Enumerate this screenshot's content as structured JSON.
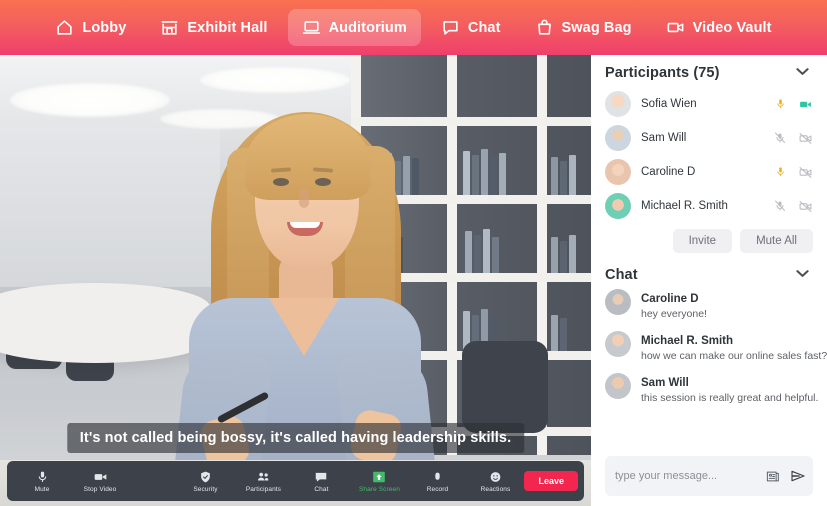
{
  "nav": {
    "items": [
      {
        "label": "Lobby",
        "icon": "home-icon",
        "active": false
      },
      {
        "label": "Exhibit Hall",
        "icon": "storefront-icon",
        "active": false
      },
      {
        "label": "Auditorium",
        "icon": "laptop-icon",
        "active": true
      },
      {
        "label": "Chat",
        "icon": "chat-bubble-icon",
        "active": false
      },
      {
        "label": "Swag Bag",
        "icon": "shopping-bag-icon",
        "active": false
      },
      {
        "label": "Video Vault",
        "icon": "video-camera-icon",
        "active": false
      }
    ]
  },
  "stage": {
    "caption": "It's not called being bossy, it's called having leadership skills.",
    "toolbar": {
      "buttons": [
        {
          "label": "Mute",
          "icon": "microphone-icon",
          "highlight": false
        },
        {
          "label": "Stop Video",
          "icon": "video-camera-icon",
          "highlight": false
        },
        {
          "label": "Security",
          "icon": "shield-icon",
          "highlight": false
        },
        {
          "label": "Participants",
          "icon": "people-icon",
          "highlight": false
        },
        {
          "label": "Chat",
          "icon": "chat-bubble-icon",
          "highlight": false
        },
        {
          "label": "Share Screen",
          "icon": "share-screen-icon",
          "highlight": true
        },
        {
          "label": "Record",
          "icon": "record-icon",
          "highlight": false
        },
        {
          "label": "Reactions",
          "icon": "reactions-icon",
          "highlight": false
        }
      ],
      "leave_label": "Leave",
      "share_color": "#3fbb6a",
      "leave_color": "#f2264f"
    }
  },
  "participants": {
    "title": "Participants (75)",
    "collapse_icon": "chevron-down-icon",
    "rows": [
      {
        "name": "Sofia Wien",
        "mic": "on",
        "cam": "on",
        "avatar_color": "#d9dcdf"
      },
      {
        "name": "Sam Will",
        "mic": "muted",
        "cam": "off",
        "avatar_color": "#cdd6de"
      },
      {
        "name": "Caroline D",
        "mic": "on",
        "cam": "off",
        "avatar_color": "#e6c5ae"
      },
      {
        "name": "Michael R. Smith",
        "mic": "muted",
        "cam": "off",
        "avatar_color": "#7fd3bb"
      }
    ],
    "invite_label": "Invite",
    "mute_all_label": "Mute All",
    "mic_on_color": "#f2b12a",
    "cam_on_color": "#2ec4a6",
    "off_color": "#b9bcc1"
  },
  "chat": {
    "title": "Chat",
    "collapse_icon": "chevron-down-icon",
    "messages": [
      {
        "name": "Caroline D",
        "text": "hey everyone!",
        "avatar_color": "#bfc2c6"
      },
      {
        "name": "Michael R. Smith",
        "text": "how we can make our online sales fast?",
        "avatar_color": "#c9ccd1"
      },
      {
        "name": "Sam Will",
        "text": "this session is really great and helpful.",
        "avatar_color": "#c4c7cb"
      }
    ],
    "composer": {
      "placeholder": "type your message...",
      "value": "",
      "attach_icon": "card-attachment-icon",
      "send_icon": "send-arrow-icon"
    }
  },
  "theme": {
    "gradient_top": "#f8714f",
    "gradient_bottom": "#ef3f6d",
    "toolbar_bg": "#3d4149"
  }
}
